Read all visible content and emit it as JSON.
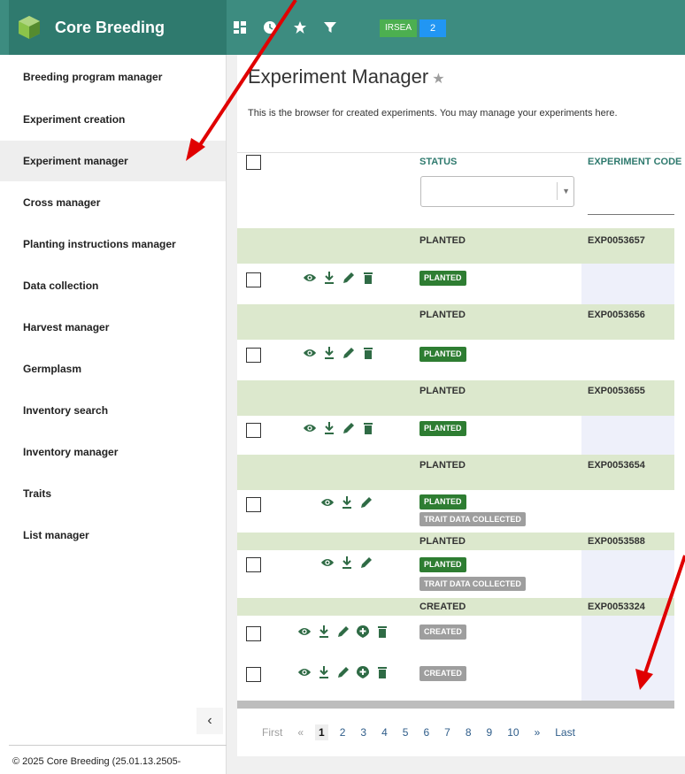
{
  "app": {
    "title": "Core Breeding"
  },
  "topbar": {
    "icons": [
      "dashboard-icon",
      "history-icon",
      "star-icon",
      "filter-icon"
    ],
    "program_badge": "IRSEA",
    "count_badge": "2"
  },
  "sidebar": {
    "items": [
      {
        "label": "Breeding program manager"
      },
      {
        "label": "Experiment creation"
      },
      {
        "label": "Experiment manager",
        "active": true
      },
      {
        "label": "Cross manager"
      },
      {
        "label": "Planting instructions manager"
      },
      {
        "label": "Data collection"
      },
      {
        "label": "Harvest manager"
      },
      {
        "label": "Germplasm"
      },
      {
        "label": "Inventory search"
      },
      {
        "label": "Inventory manager"
      },
      {
        "label": "Traits"
      },
      {
        "label": "List manager"
      }
    ],
    "collapse_glyph": "‹",
    "footer": "© 2025 Core Breeding (25.01.13.2505-"
  },
  "main": {
    "title": "Experiment Manager",
    "description": "This is the browser for created experiments. You may manage your experiments here.",
    "columns": {
      "status": "STATUS",
      "experiment_code": "EXPERIMENT CODE"
    },
    "groups": [
      {
        "status": "PLANTED",
        "code": "EXP0053657",
        "rows": [
          {
            "chips": [
              "PLANTED"
            ],
            "actions": [
              "view",
              "download",
              "edit",
              "delete"
            ]
          }
        ]
      },
      {
        "status": "PLANTED",
        "code": "EXP0053656",
        "rows": [
          {
            "chips": [
              "PLANTED"
            ],
            "actions": [
              "view",
              "download",
              "edit",
              "delete"
            ]
          }
        ]
      },
      {
        "status": "PLANTED",
        "code": "EXP0053655",
        "rows": [
          {
            "chips": [
              "PLANTED"
            ],
            "actions": [
              "view",
              "download",
              "edit",
              "delete"
            ]
          }
        ]
      },
      {
        "status": "PLANTED",
        "code": "EXP0053654",
        "rows": [
          {
            "chips": [
              "PLANTED",
              "TRAIT DATA COLLECTED"
            ],
            "actions": [
              "view",
              "download",
              "edit"
            ]
          }
        ]
      },
      {
        "status": "PLANTED",
        "code": "EXP0053588",
        "rows": [
          {
            "chips": [
              "PLANTED",
              "TRAIT DATA COLLECTED"
            ],
            "actions": [
              "view",
              "download",
              "edit"
            ]
          }
        ]
      },
      {
        "status": "CREATED",
        "code": "EXP0053324",
        "rows": [
          {
            "chips": [
              "CREATED"
            ],
            "actions": [
              "view",
              "download",
              "edit",
              "add",
              "delete"
            ]
          },
          {
            "chips": [
              "CREATED"
            ],
            "actions": [
              "view",
              "download",
              "edit",
              "add",
              "delete"
            ]
          }
        ]
      }
    ],
    "pagination": {
      "first": "First",
      "prev": "«",
      "pages": [
        "1",
        "2",
        "3",
        "4",
        "5",
        "6",
        "7",
        "8",
        "9",
        "10"
      ],
      "current": "1",
      "next": "»",
      "last": "Last"
    }
  },
  "colors": {
    "topbar": "#3d8c80",
    "brand": "#2f7a6e",
    "group_row": "#dce8cd",
    "planted_chip": "#2e7d32",
    "muted_chip": "#9e9e9e",
    "annotation_arrow": "#e00000"
  }
}
